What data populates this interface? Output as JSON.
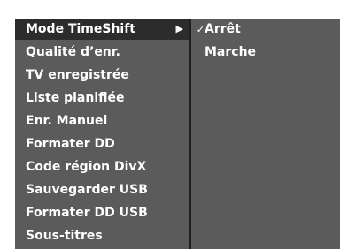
{
  "menu": {
    "items": [
      {
        "label": "Mode TimeShift",
        "selected": true,
        "arrow": "▶"
      },
      {
        "label": "Qualité d’enr."
      },
      {
        "label": "TV enregistrée"
      },
      {
        "label": "Liste planifiée"
      },
      {
        "label": "Enr. Manuel"
      },
      {
        "label": "Formater DD"
      },
      {
        "label": "Code région DivX"
      },
      {
        "label": "Sauvegarder USB"
      },
      {
        "label": "Formater DD USB"
      },
      {
        "label": "Sous-titres"
      }
    ]
  },
  "submenu": {
    "options": [
      {
        "label": "Arrêt",
        "checked": true,
        "check_mark": "✓"
      },
      {
        "label": "Marche",
        "checked": false,
        "check_mark": ""
      }
    ]
  },
  "colors": {
    "panel_background": "#5b5b5b",
    "selected_background": "#2c2c2c",
    "divider": "#1e1e1e",
    "text": "#ffffff"
  }
}
